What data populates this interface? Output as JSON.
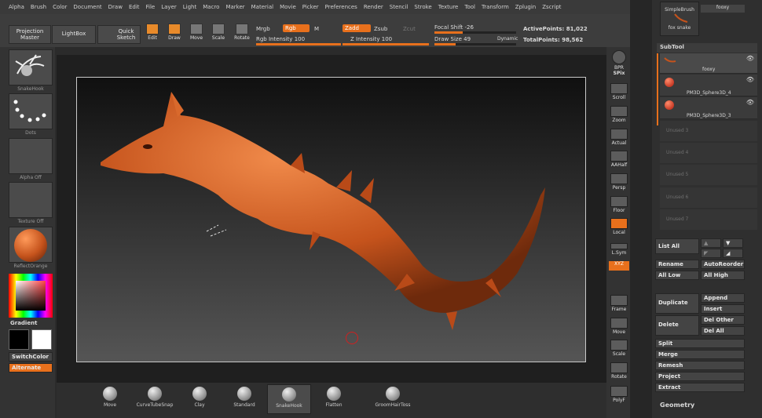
{
  "menu": [
    "Alpha",
    "Brush",
    "Color",
    "Document",
    "Draw",
    "Edit",
    "File",
    "Layer",
    "Light",
    "Macro",
    "Marker",
    "Material",
    "Movie",
    "Picker",
    "Preferences",
    "Render",
    "Stencil",
    "Stroke",
    "Texture",
    "Tool",
    "Transform",
    "Zplugin",
    "Zscript"
  ],
  "toolbar": {
    "projection_master": "Projection Master",
    "lightbox": "LightBox",
    "quick_sketch": "Quick Sketch",
    "edit": "Edit",
    "draw": "Draw",
    "move": "Move",
    "scale": "Scale",
    "rotate": "Rotate",
    "mrgb": "Mrgb",
    "rgb": "Rgb",
    "m": "M",
    "rgb_intensity_label": "Rgb Intensity",
    "rgb_intensity_value": "100",
    "rgb_intensity_fraction": 1.0,
    "zadd": "Zadd",
    "zsub": "Zsub",
    "zcut": "Zcut",
    "z_intensity_label": "Z Intensity",
    "z_intensity_value": "100",
    "z_intensity_fraction": 1.0,
    "focal_shift_label": "Focal Shift",
    "focal_shift_value": "-26",
    "draw_size_label": "Draw Size",
    "draw_size_value": "49",
    "dynamic": "Dynamic",
    "active_points_label": "ActivePoints:",
    "active_points_value": "81,022",
    "total_points_label": "TotalPoints:",
    "total_points_value": "98,562"
  },
  "left": {
    "brush_thumb": "SnakeHook",
    "stroke_thumb": "Dots",
    "alpha_thumb": "Alpha Off",
    "texture_thumb": "Texture Off",
    "material_thumb": "ReflectOrange",
    "gradient": "Gradient",
    "switch_color": "SwitchColor",
    "alternate": "Alternate"
  },
  "shelf": [
    {
      "label": "Move"
    },
    {
      "label": "CurveTubeSnap"
    },
    {
      "label": "Clay"
    },
    {
      "label": "Standard"
    },
    {
      "label": "SnakeHook"
    },
    {
      "label": "Flatten"
    },
    {
      "label": "GroomHairToss"
    }
  ],
  "right_shelf": [
    "BPR",
    "SPix",
    "Scroll",
    "Zoom",
    "Actual",
    "AAHalf",
    "Persp",
    "Floor",
    "Local",
    "L.Sym",
    "XYZ",
    "Frame",
    "Move",
    "Scale",
    "Rotate",
    "PolyF"
  ],
  "rpanel": {
    "simple_brush": "SimpleBrush",
    "fooxy_top": "fooxy",
    "fox_snake": "fox snake",
    "subtool_title": "SubTool",
    "subtools": [
      "fooxy",
      "PM3D_Sphere3D_4",
      "PM3D_Sphere3D_3"
    ],
    "unused": [
      "Unused 3",
      "Unused 4",
      "Unused 5",
      "Unused 6",
      "Unused 7"
    ],
    "list_all": "List All",
    "rename": "Rename",
    "auto_reorder": "AutoReorder",
    "all_low": "All Low",
    "all_high": "All High",
    "duplicate": "Duplicate",
    "append": "Append",
    "insert": "Insert",
    "delete": "Delete",
    "del_other": "Del Other",
    "del_all": "Del All",
    "split": "Split",
    "merge": "Merge",
    "remesh": "Remesh",
    "project": "Project",
    "extract": "Extract",
    "geometry": "Geometry"
  },
  "colors": {
    "accent": "#e8701c",
    "model": "#c5531c"
  }
}
